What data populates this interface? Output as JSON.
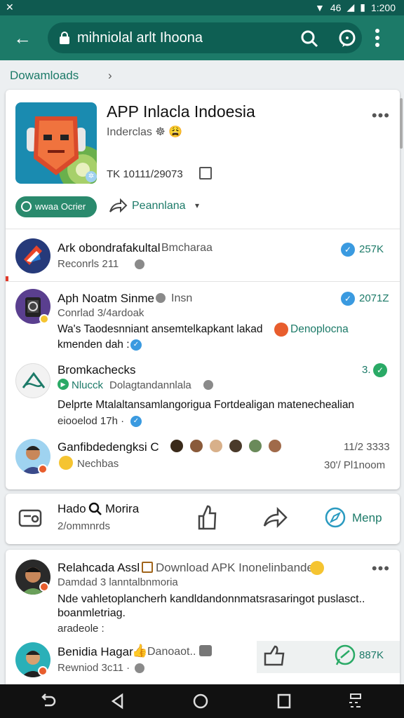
{
  "status_bar": {
    "network": "46",
    "time": "1:200"
  },
  "app_bar": {
    "url": "mihniolal arlt Ihoona",
    "back_icon": "arrow-left-icon",
    "lock_icon": "lock-icon",
    "search_icon": "search-icon",
    "chat_icon": "chat-bubble-icon",
    "menu_icon": "more-vertical-icon"
  },
  "breadcrumb": {
    "label": "Dowamloads",
    "chevron": "›"
  },
  "app_card": {
    "title": "APP Inlacla Indoesia",
    "subtitle": "Inderclas ☸ 😩",
    "code": "TK 10111/29073",
    "more": "•••",
    "primary_button": "wwaa Ocrier",
    "share_label": "Peannlana",
    "caret": "▾"
  },
  "feed": [
    {
      "title": "Ark obondrafakultal",
      "title_extra": "Bmcharaa",
      "sub": "Reconrls 211",
      "count": "257K"
    },
    {
      "title": "Aph Noatm Sinme",
      "title_extra": "Insn",
      "sub": "Conrlad 3/4ardoak",
      "body": "Wa's Taodesnniant ansemtelkapkant lakad",
      "body_link": "Denoplocna",
      "body2": "kmenden dah :",
      "count": "2071Z"
    },
    {
      "title": "Bromkachecks",
      "sub_tag": "Nlucck",
      "sub": "Dolagtandannlala",
      "body": "Delprte Mtalaltansamlangorigua Fortdealigan matenechealian",
      "body2": "eiooelod 17h ·",
      "count": "3."
    },
    {
      "title": "Ganfibdedengksi C",
      "sub": "Nechbas",
      "count": "11/2 3333",
      "count2": "30'/ Pl1noom"
    }
  ],
  "action_bar": {
    "title": "Hado",
    "title_extra": "Morira",
    "sub": "2/ommnrds",
    "cta": "Menp"
  },
  "post": {
    "title": "Relahcada Assl",
    "title_extra": "Download APK Inonelinbanden",
    "sub": "Damdad 3 lanntalbnmoria",
    "body_line1": "Nde vahletoplancherh kandldandonnmatsrasaringot puslasct..",
    "body_line2": "boanmletriag.",
    "body_line3": "aradeole :",
    "more": "•••",
    "reply_title": "Benidia Hagar",
    "reply_extra": "Danoaot..",
    "reply_sub": "Rewniod 3c11 ·",
    "reply_count": "887K"
  },
  "colors": {
    "primary": "#1c7a68",
    "status": "#0f5a50",
    "accent_blue": "#3a9ae0"
  }
}
